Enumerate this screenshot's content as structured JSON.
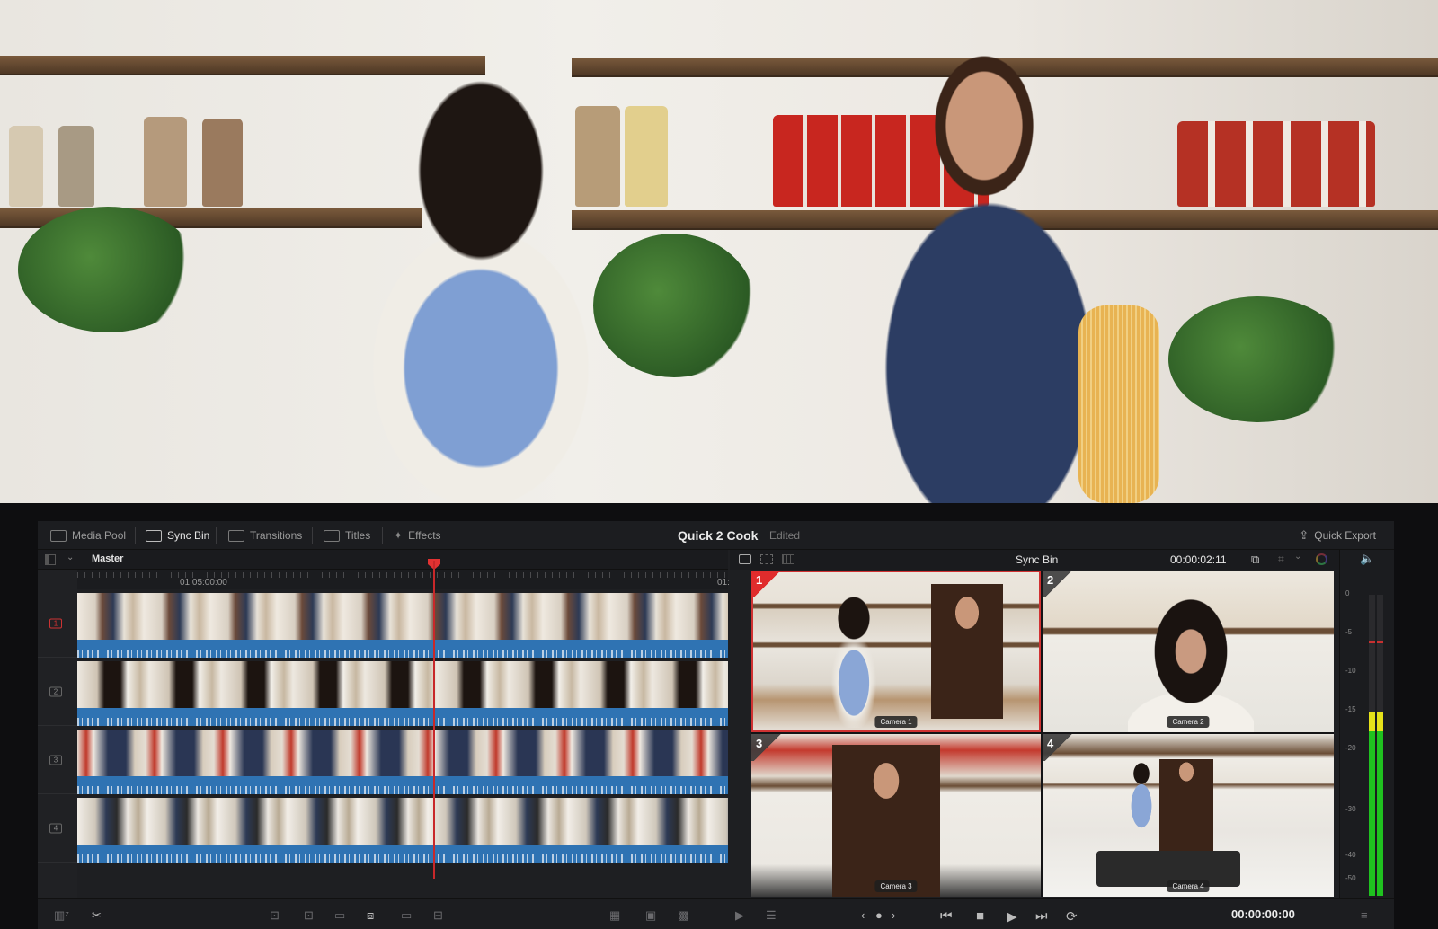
{
  "toolbar": {
    "tabs": [
      {
        "label": "Media Pool",
        "icon": "media-pool-icon",
        "active": false
      },
      {
        "label": "Sync Bin",
        "icon": "sync-bin-icon",
        "active": true
      },
      {
        "label": "Transitions",
        "icon": "transitions-icon",
        "active": false
      },
      {
        "label": "Titles",
        "icon": "titles-icon",
        "active": false
      },
      {
        "label": "Effects",
        "icon": "effects-icon",
        "active": false
      }
    ],
    "project_title": "Quick 2 Cook",
    "project_status": "Edited",
    "quick_export_label": "Quick Export"
  },
  "timeline": {
    "bin_name": "Master",
    "ruler_labels": [
      "01:05:00:00",
      "01:"
    ],
    "tracks": [
      {
        "number": "1",
        "active": true
      },
      {
        "number": "2",
        "active": false
      },
      {
        "number": "3",
        "active": false
      },
      {
        "number": "4",
        "active": false
      }
    ]
  },
  "viewer": {
    "title": "Sync Bin",
    "timecode": "00:00:02:11",
    "angles": [
      {
        "number": "1",
        "label": "Camera 1",
        "selected": true
      },
      {
        "number": "2",
        "label": "Camera 2",
        "selected": false
      },
      {
        "number": "3",
        "label": "Camera 3",
        "selected": false
      },
      {
        "number": "4",
        "label": "Camera 4",
        "selected": false
      }
    ]
  },
  "audio_meter": {
    "scale": [
      "0",
      "-5",
      "-10",
      "-15",
      "-20",
      "-30",
      "-40",
      "-50"
    ],
    "level_db": -15,
    "peak_hold_db": -6,
    "colors": {
      "green": "#1fc21f",
      "yellow": "#e6e21a",
      "peak": "#c83030"
    }
  },
  "transport": {
    "timecode": "00:00:00:00"
  },
  "accent_color": "#e02c2c"
}
